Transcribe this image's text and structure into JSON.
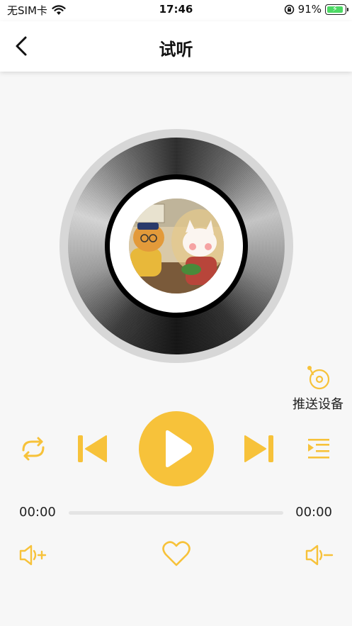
{
  "status_bar": {
    "carrier": "无SIM卡",
    "time": "17:46",
    "battery_percent": "91%",
    "battery_level": 0.91,
    "charging": true
  },
  "nav": {
    "title": "试听",
    "back_icon": "chevron-left-icon"
  },
  "player": {
    "cover_icon": "album-cover-image",
    "push_device_label": "推送设备",
    "push_device_icon": "record-player-icon",
    "current_time": "00:00",
    "total_time": "00:00",
    "progress": 0,
    "controls": [
      "repeat-icon",
      "previous-icon",
      "play-icon",
      "next-icon",
      "playlist-icon"
    ],
    "bottom_controls": [
      "volume-up-icon",
      "heart-icon",
      "volume-down-icon"
    ],
    "accent_color": "#f7c23a"
  }
}
